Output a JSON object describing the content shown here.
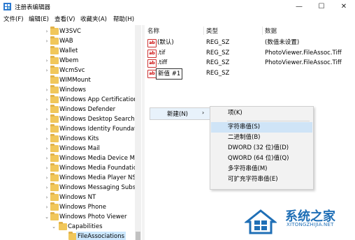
{
  "window": {
    "title": "注册表编辑器",
    "minimize": "—",
    "maximize": "☐",
    "close": "✕"
  },
  "menu": [
    "文件(F)",
    "编辑(E)",
    "查看(V)",
    "收藏夹(A)",
    "帮助(H)"
  ],
  "tree": [
    {
      "label": "W3SVC",
      "arrow": "›"
    },
    {
      "label": "WAB",
      "arrow": "›"
    },
    {
      "label": "Wallet",
      "arrow": ""
    },
    {
      "label": "Wbem",
      "arrow": "›"
    },
    {
      "label": "WcmSvc",
      "arrow": "›"
    },
    {
      "label": "WIMMount",
      "arrow": ""
    },
    {
      "label": "Windows",
      "arrow": "›"
    },
    {
      "label": "Windows App Certification",
      "arrow": "›"
    },
    {
      "label": "Windows Defender",
      "arrow": "›"
    },
    {
      "label": "Windows Desktop Search",
      "arrow": "›"
    },
    {
      "label": "Windows Identity Foundati",
      "arrow": "›"
    },
    {
      "label": "Windows Kits",
      "arrow": "›"
    },
    {
      "label": "Windows Mail",
      "arrow": "›"
    },
    {
      "label": "Windows Media Device M",
      "arrow": "›"
    },
    {
      "label": "Windows Media Foundatic",
      "arrow": "›"
    },
    {
      "label": "Windows Media Player NS",
      "arrow": "›"
    },
    {
      "label": "Windows Messaging Subs",
      "arrow": "›"
    },
    {
      "label": "Windows NT",
      "arrow": "›"
    },
    {
      "label": "Windows Phone",
      "arrow": "›"
    },
    {
      "label": "Windows Photo Viewer",
      "arrow": "⌄"
    },
    {
      "label": "Capabilities",
      "arrow": "⌄"
    },
    {
      "label": "FileAssociations",
      "arrow": ""
    }
  ],
  "list": {
    "headers": {
      "name": "名称",
      "type": "类型",
      "data": "数据"
    },
    "rows": [
      {
        "name": "(默认)",
        "type": "REG_SZ",
        "data": "(数值未设置)"
      },
      {
        "name": ".tif",
        "type": "REG_SZ",
        "data": "PhotoViewer.FileAssoc.Tiff"
      },
      {
        "name": ".tiff",
        "type": "REG_SZ",
        "data": "PhotoViewer.FileAssoc.Tiff"
      },
      {
        "name": "新值 #1",
        "type": "REG_SZ",
        "data": ""
      }
    ]
  },
  "context": {
    "new_label": "新建(N)",
    "arrow": "›"
  },
  "submenu": [
    "项(K)",
    "字符串值(S)",
    "二进制值(B)",
    "DWORD (32 位)值(D)",
    "QWORD (64 位)值(Q)",
    "多字符串值(M)",
    "可扩充字符串值(E)"
  ],
  "watermark": {
    "brand": "系统之家",
    "site": "XITONGZHIJIA.NET"
  },
  "icons": {
    "value_icon": "ab"
  },
  "colors": {
    "selection": "#cce8ff",
    "folder": "#f1c75b",
    "watermark": "#1f6fb6"
  }
}
